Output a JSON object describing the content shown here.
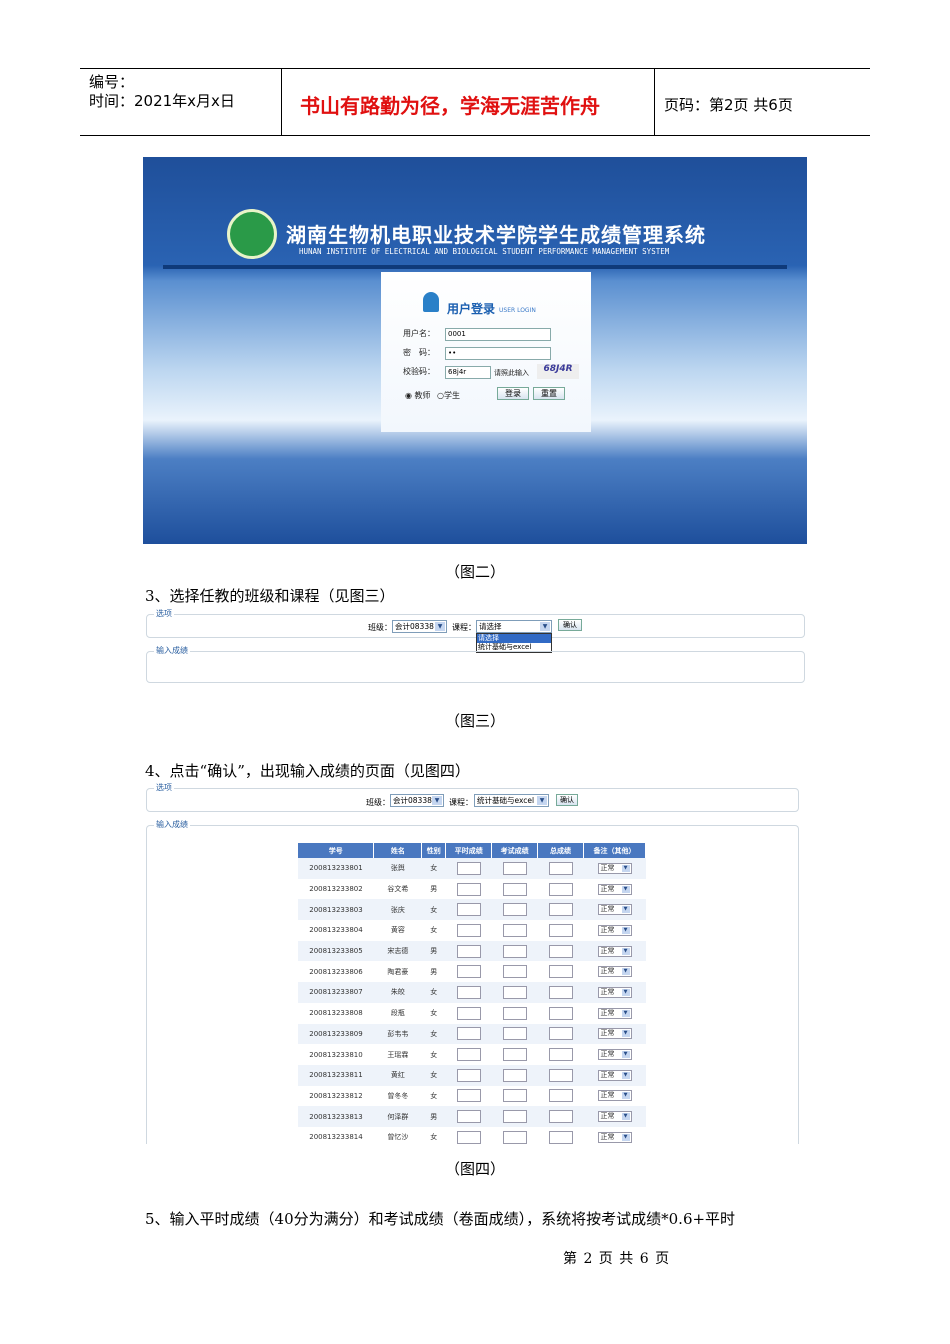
{
  "header": {
    "number_label": "编号：",
    "time_label": "时间：2021年x月x日",
    "motto": "书山有路勤为径，学海无涯苦作舟",
    "page_label": "页码：第2页  共6页"
  },
  "login": {
    "title": "湖南生物机电职业技术学院学生成绩管理系统",
    "subtitle": "HUNAN INSTITUTE OF ELECTRICAL AND BIOLOGICAL STUDENT PERFORMANCE MANAGEMENT SYSTEM",
    "panel_title": "用户登录",
    "panel_title_en": "USER LOGIN",
    "username_label": "用户名：",
    "username_value": "0001",
    "password_label": "密　码：",
    "password_value": "••",
    "captcha_label": "校验码：",
    "captcha_value": "68j4r",
    "captcha_hint": "请照此输入",
    "captcha_image": "68J4R",
    "role_teacher": "教师",
    "role_student": "学生",
    "login_button": "登录",
    "reset_button": "重置"
  },
  "captions": {
    "fig2": "（图二）",
    "fig3": "（图三）",
    "fig4": "（图四）"
  },
  "steps": {
    "step3": "3、选择任教的班级和课程（见图三）",
    "step4": "4、点击“确认”，出现输入成绩的页面（见图四）",
    "step5": "5、输入平时成绩（40分为满分）和考试成绩（卷面成绩），系统将按考试成绩*0.6+平时"
  },
  "fig3": {
    "legend_options": "选项",
    "legend_input": "输入成绩",
    "class_label": "班级：",
    "class_value": "会计08338",
    "course_label": "课程：",
    "course_value": "请选择",
    "confirm": "确认",
    "dropdown": [
      "请选择",
      "统计基础与excel"
    ]
  },
  "fig4": {
    "legend_options": "选项",
    "legend_input": "输入成绩",
    "class_label": "班级：",
    "class_value": "会计08338",
    "course_label": "课程：",
    "course_value": "统计基础与excel",
    "confirm": "确认",
    "columns": [
      "学号",
      "姓名",
      "性别",
      "平时成绩",
      "考试成绩",
      "总成绩",
      "备注（其他）"
    ],
    "rows": [
      [
        "200813233801",
        "张舆",
        "女",
        "正常"
      ],
      [
        "200813233802",
        "谷文希",
        "男",
        "正常"
      ],
      [
        "200813233803",
        "张庆",
        "女",
        "正常"
      ],
      [
        "200813233804",
        "黄容",
        "女",
        "正常"
      ],
      [
        "200813233805",
        "宋志德",
        "男",
        "正常"
      ],
      [
        "200813233806",
        "陶君豪",
        "男",
        "正常"
      ],
      [
        "200813233807",
        "朱皎",
        "女",
        "正常"
      ],
      [
        "200813233808",
        "段瓶",
        "女",
        "正常"
      ],
      [
        "200813233809",
        "彭韦韦",
        "女",
        "正常"
      ],
      [
        "200813233810",
        "王瑶霖",
        "女",
        "正常"
      ],
      [
        "200813233811",
        "黄红",
        "女",
        "正常"
      ],
      [
        "200813233812",
        "曾冬冬",
        "女",
        "正常"
      ],
      [
        "200813233813",
        "何泽群",
        "男",
        "正常"
      ],
      [
        "200813233814",
        "曾忆沙",
        "女",
        "正常"
      ]
    ]
  },
  "footer": "第 2 页 共 6 页"
}
